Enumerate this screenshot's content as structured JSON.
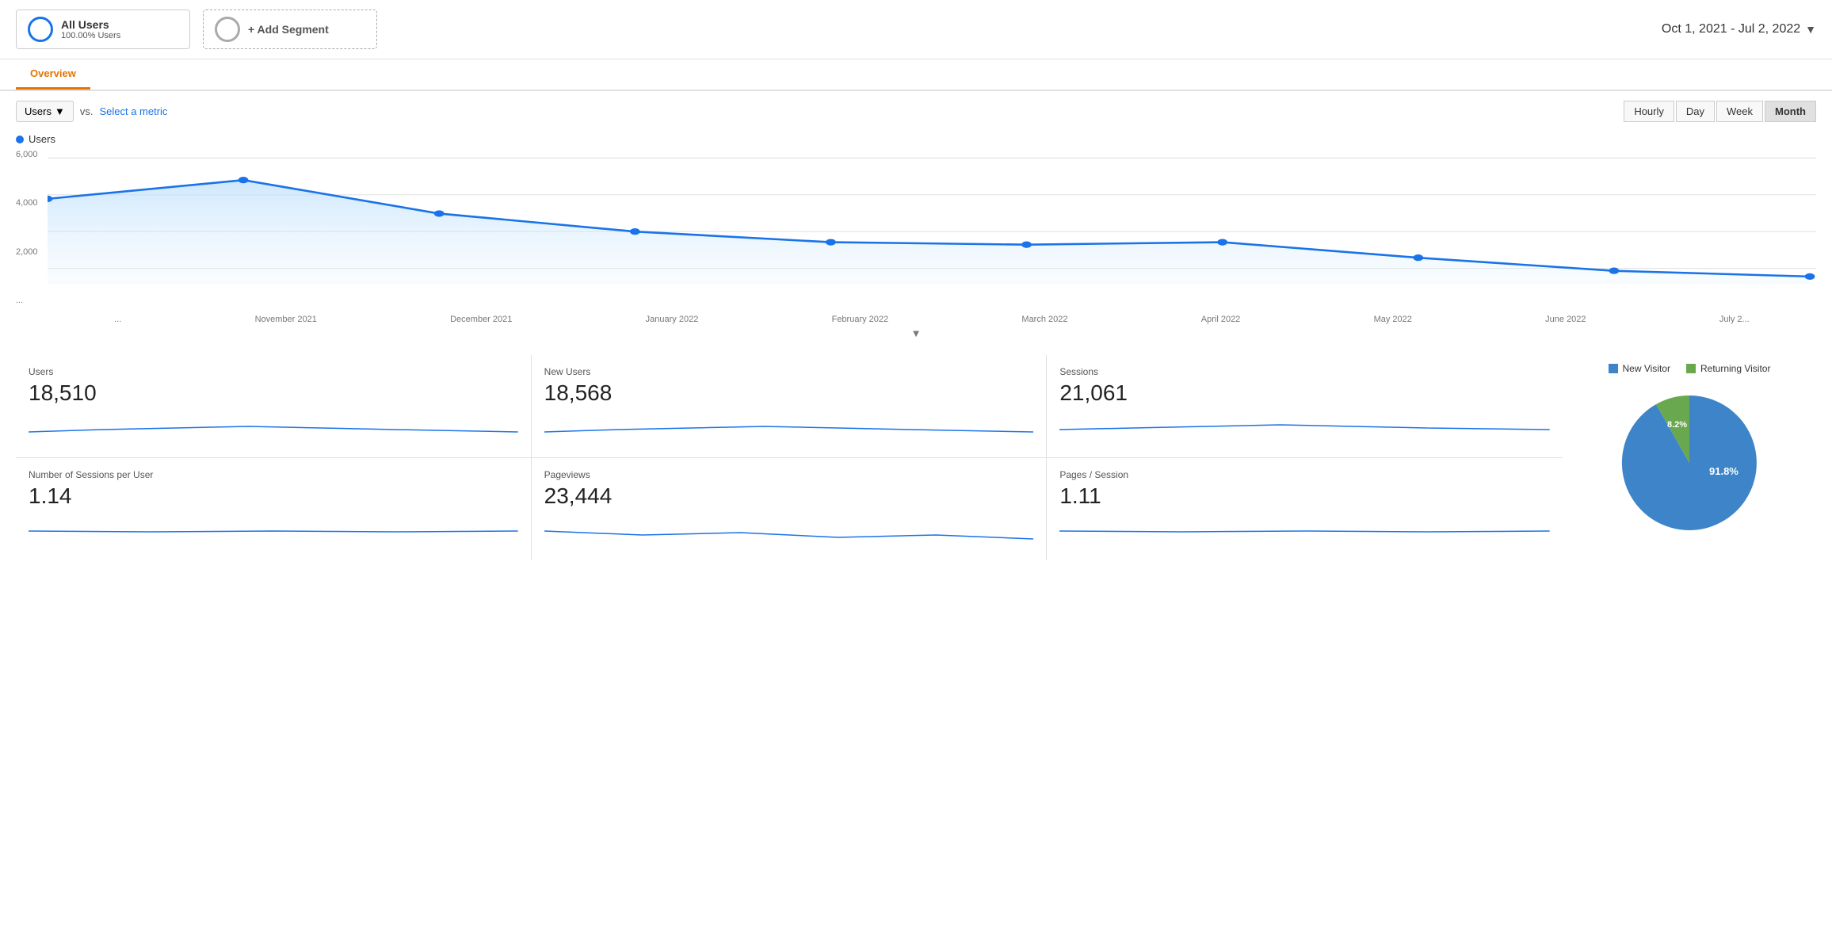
{
  "header": {
    "segment1": {
      "label": "All Users",
      "sublabel": "100.00% Users"
    },
    "segment2": {
      "label": "+ Add Segment"
    },
    "dateRange": "Oct 1, 2021 - Jul 2, 2022"
  },
  "tabs": [
    {
      "label": "Overview",
      "active": true
    }
  ],
  "chart": {
    "metricLabel": "Users",
    "vsLabel": "vs.",
    "selectMetricLabel": "Select a metric",
    "legendLabel": "Users",
    "yLabels": [
      "6,000",
      "4,000",
      "2,000",
      "..."
    ],
    "xLabels": [
      "...",
      "November 2021",
      "December 2021",
      "January 2022",
      "February 2022",
      "March 2022",
      "April 2022",
      "May 2022",
      "June 2022",
      "July 2..."
    ],
    "timeButtons": [
      {
        "label": "Hourly",
        "active": false
      },
      {
        "label": "Day",
        "active": false
      },
      {
        "label": "Week",
        "active": false
      },
      {
        "label": "Month",
        "active": true
      }
    ]
  },
  "stats": [
    {
      "name": "Users",
      "value": "18,510"
    },
    {
      "name": "New Users",
      "value": "18,568"
    },
    {
      "name": "Sessions",
      "value": "21,061"
    },
    {
      "name": "Number of Sessions per User",
      "value": "1.14"
    },
    {
      "name": "Pageviews",
      "value": "23,444"
    },
    {
      "name": "Pages / Session",
      "value": "1.11"
    }
  ],
  "pie": {
    "newVisitor": {
      "label": "New Visitor",
      "percentage": "91.8%",
      "color": "#3d85c8"
    },
    "returningVisitor": {
      "label": "Returning Visitor",
      "percentage": "8.2%",
      "color": "#6aa84f"
    }
  }
}
